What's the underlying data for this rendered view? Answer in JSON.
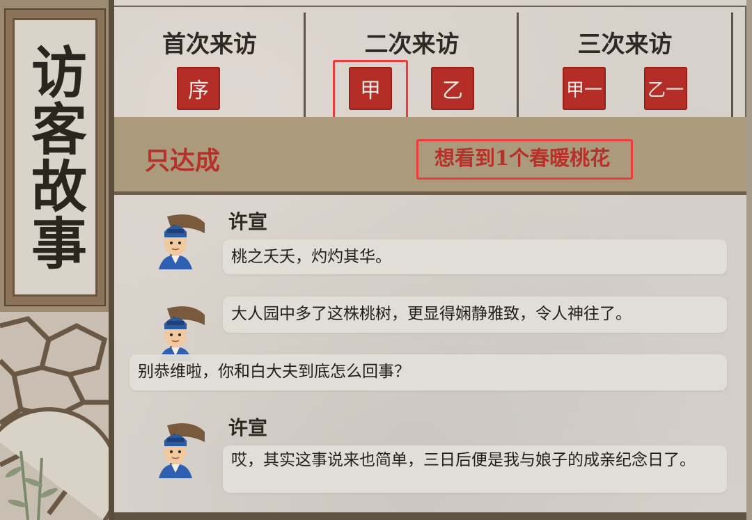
{
  "left_panel": {
    "title": "访客故事"
  },
  "tabs": [
    {
      "title": "首次来访",
      "seals": [
        "序"
      ]
    },
    {
      "title": "二次来访",
      "seals": [
        "甲",
        "乙"
      ]
    },
    {
      "title": "三次来访",
      "seals": [
        "甲一",
        "乙一"
      ]
    }
  ],
  "condition_bar": {
    "visitor_name": "只达成",
    "condition": "想看到1个春暖桃花"
  },
  "dialog": [
    {
      "speaker": "许宣",
      "text": "桃之夭夭，灼灼其华。"
    },
    {
      "speaker": "",
      "text": "大人园中多了这株桃树，更显得娴静雅致，令人神往了。"
    },
    {
      "speaker": "",
      "text": "别恭维啦，你和白大夫到底怎么回事？"
    },
    {
      "speaker": "许宣",
      "text": "哎，其实这事说来也简单，三日后便是我与娘子的成亲纪念日了。"
    }
  ],
  "colors": {
    "seal_red": "#b42d26",
    "accent_red": "#b5312a",
    "highlight_red": "#ec3b3b",
    "bar_tan": "#ab9a7c"
  }
}
